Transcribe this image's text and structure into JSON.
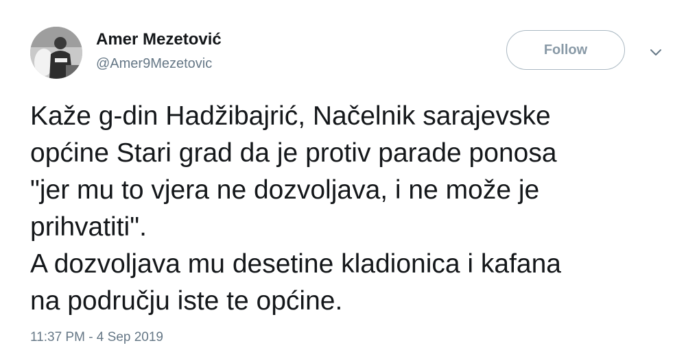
{
  "author": {
    "display_name": "Amer Mezetović",
    "handle": "@Amer9Mezetovic",
    "avatar_icon": "profile-photo"
  },
  "actions": {
    "follow_label": "Follow",
    "menu_icon": "chevron-down-icon"
  },
  "tweet": {
    "text": "Kaže g-din Hadžibajrić, Načelnik sarajevske\nopćine Stari grad da je protiv parade ponosa\n\"jer mu to vjera ne dozvoljava, i ne može je\nprihvatiti\".\nA dozvoljava mu desetine kladionica i kafana\nna području iste te općine.",
    "timestamp": "11:37 PM - 4 Sep 2019"
  },
  "colors": {
    "text": "#14171a",
    "secondary": "#657786",
    "button_border": "#aab8c2",
    "button_text": "#8899a6"
  }
}
